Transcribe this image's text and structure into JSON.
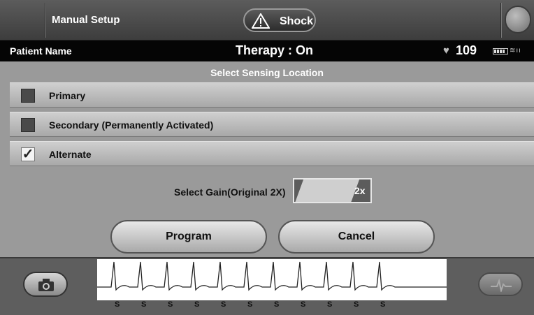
{
  "header": {
    "manual_setup": "Manual Setup",
    "shock_label": "Shock"
  },
  "status": {
    "patient_name": "Patient Name",
    "therapy": "Therapy : On",
    "heart_rate": "109"
  },
  "sensing": {
    "title": "Select Sensing Location",
    "options": [
      {
        "label": "Primary",
        "checked": false
      },
      {
        "label": "Secondary (Permanently Activated)",
        "checked": false
      },
      {
        "label": "Alternate",
        "checked": true
      }
    ]
  },
  "gain": {
    "label": "Select Gain(Original 2X)",
    "value": "2x"
  },
  "buttons": {
    "program": "Program",
    "cancel": "Cancel"
  },
  "ecg": {
    "sense_marker": "S",
    "beat_count": 11,
    "rhythm": "sinus"
  },
  "colors": {
    "background": "#9a9a9a",
    "status_bar": "#050505"
  },
  "icons": [
    "warning-icon",
    "wand-icon",
    "heart-icon",
    "battery-icon",
    "telemetry-icon",
    "camera-icon",
    "ecg-icon"
  ]
}
